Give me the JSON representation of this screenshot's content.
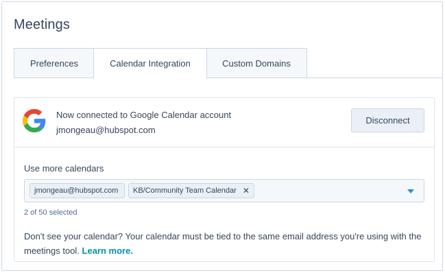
{
  "page": {
    "title": "Meetings"
  },
  "tabs": [
    {
      "label": "Preferences",
      "active": false
    },
    {
      "label": "Calendar Integration",
      "active": true
    },
    {
      "label": "Custom Domains",
      "active": false
    }
  ],
  "connection": {
    "status_text": "Now connected to Google Calendar account",
    "email": "jmongeau@hubspot.com",
    "disconnect_label": "Disconnect",
    "logo_icon": "google-g-icon"
  },
  "calendars": {
    "label": "Use more calendars",
    "chips": [
      {
        "label": "jmongeau@hubspot.com",
        "removable": false
      },
      {
        "label": "KB/Community Team Calendar",
        "removable": true,
        "remove_glyph": "✕"
      }
    ],
    "count_text": "2 of 50 selected",
    "dropdown_icon": "caret-down-icon"
  },
  "help": {
    "text": "Don't see your calendar? Your calendar must be tied to the same email address you're using with the meetings tool. ",
    "link_label": "Learn more."
  },
  "colors": {
    "text": "#33475b",
    "link": "#0091ae",
    "caret": "#2d8fc5",
    "border": "#cbd6e2",
    "button_bg": "#eaf0f6"
  }
}
